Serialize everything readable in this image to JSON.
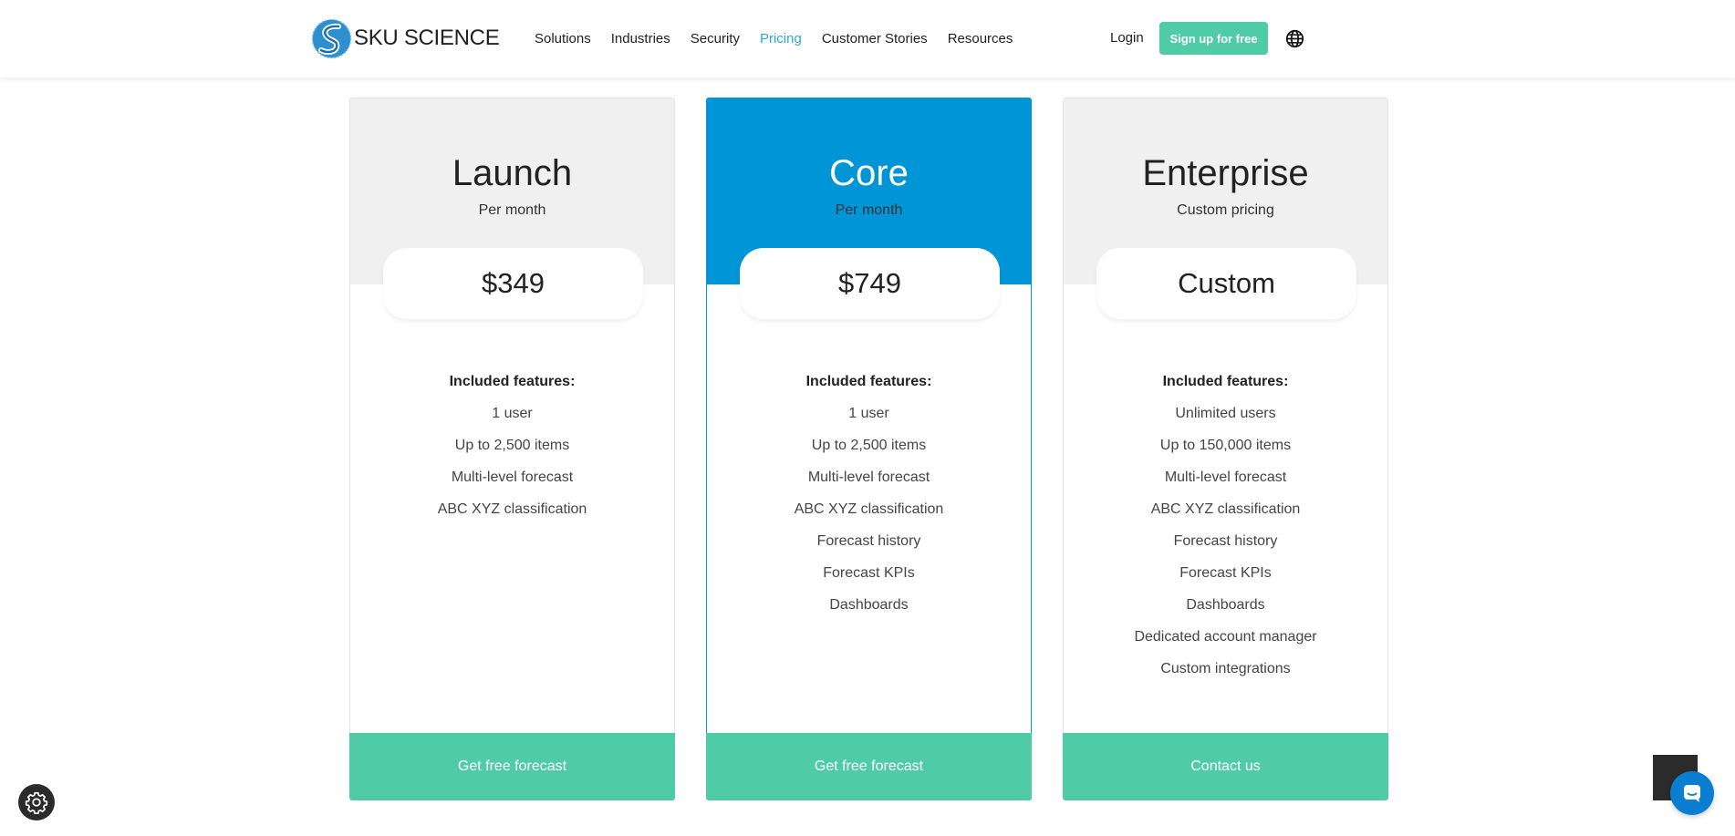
{
  "header": {
    "logo_text": "SKU SCIENCE",
    "nav": [
      {
        "label": "Solutions",
        "active": false
      },
      {
        "label": "Industries",
        "active": false
      },
      {
        "label": "Security",
        "active": false
      },
      {
        "label": "Pricing",
        "active": true
      },
      {
        "label": "Customer Stories",
        "active": false
      },
      {
        "label": "Resources",
        "active": false
      }
    ],
    "login_label": "Login",
    "signup_label": "Sign up for free",
    "globe_icon": "globe-icon"
  },
  "plans": [
    {
      "name": "Launch",
      "subtitle": "Per month",
      "price": "$349",
      "features_title": "Included features:",
      "features": [
        "1 user",
        "Up to 2,500 items",
        "Multi-level forecast",
        "ABC XYZ classification"
      ],
      "cta": "Get free forecast"
    },
    {
      "name": "Core",
      "subtitle": "Per month",
      "price": "$749",
      "features_title": "Included features:",
      "features": [
        "1 user",
        "Up to 2,500 items",
        "Multi-level forecast",
        "ABC XYZ classification",
        "Forecast history",
        "Forecast KPIs",
        "Dashboards"
      ],
      "cta": "Get free forecast"
    },
    {
      "name": "Enterprise",
      "subtitle": "Custom pricing",
      "price": "Custom",
      "features_title": "Included features:",
      "features": [
        "Unlimited users",
        "Up to 150,000 items",
        "Multi-level forecast",
        "ABC XYZ classification",
        "Forecast history",
        "Forecast KPIs",
        "Dashboards",
        "Dedicated account manager",
        "Custom integrations"
      ],
      "cta": "Contact us"
    }
  ],
  "colors": {
    "accent_green": "#4fcba6",
    "core_blue": "#0095d6",
    "nav_active": "#2ea7d8",
    "card_header_gray": "#f0f0f0"
  },
  "widgets": {
    "cookie_icon": "gear-icon",
    "chat_icon": "chat-icon"
  }
}
